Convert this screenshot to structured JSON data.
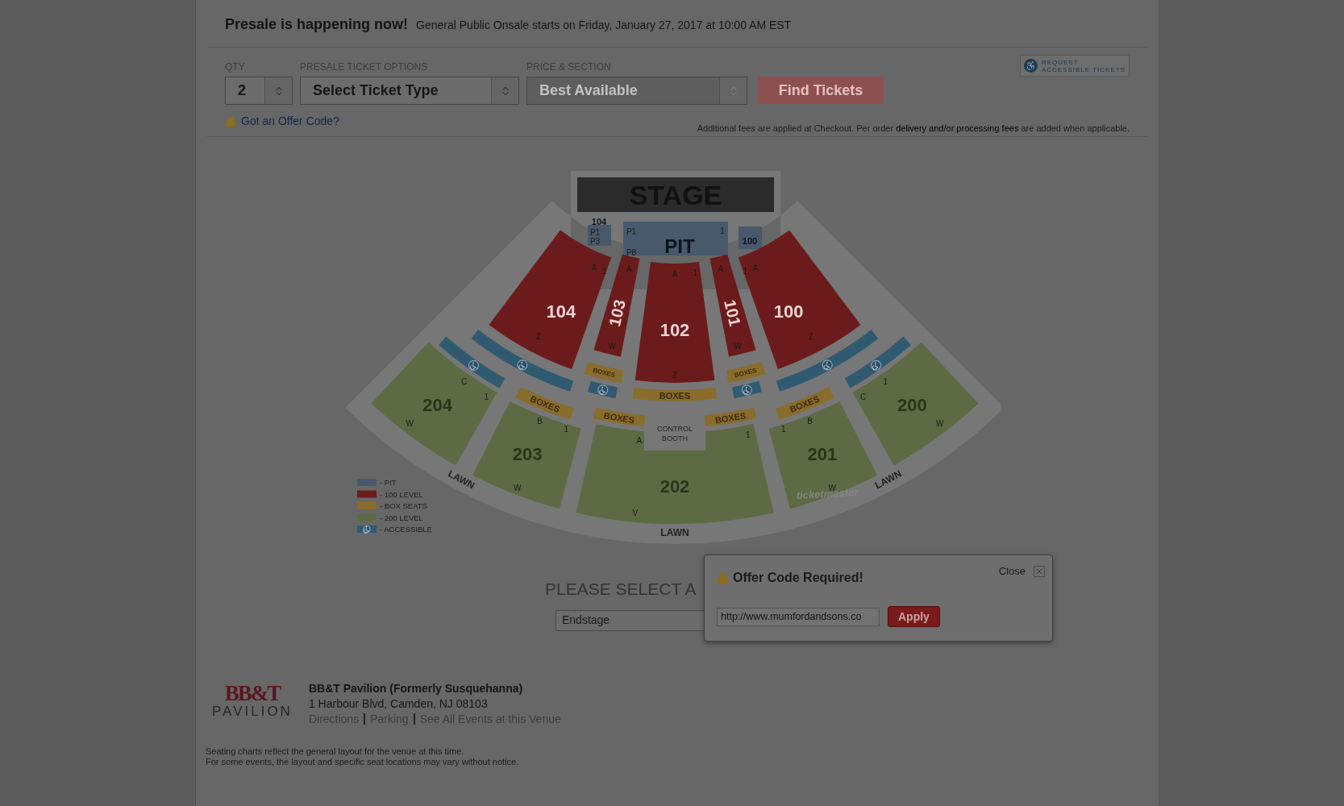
{
  "notice": {
    "title": "Presale is happening now!",
    "text": "General Public Onsale starts on Friday, January 27, 2017 at 10:00 AM EST"
  },
  "filters": [
    {
      "kind": "qty",
      "label": "QTY",
      "value": "2",
      "disabled": false
    },
    {
      "kind": "ticket_type",
      "label": "PRESALE TICKET OPTIONS",
      "value": "Select Ticket Type",
      "disabled": false
    },
    {
      "kind": "price",
      "label": "PRICE & SECTION",
      "value": "Best Available",
      "disabled": true
    }
  ],
  "find_button": {
    "label": "Find Tickets",
    "disabled": true
  },
  "accessible_button": {
    "lines": [
      "REQUEST",
      "ACCESSIBLE TICKETS"
    ]
  },
  "offer_link": "Got an Offer Code?",
  "fees_note": "Additional fees are applied at Checkout. Per order **delivery and/or processing fees** are added when applicable.",
  "seat_map": {
    "stage": "STAGE",
    "control_booth": [
      "CONTROL",
      "BOOTH"
    ],
    "lawn": [
      "LAWN",
      "LAWN",
      "LAWN"
    ],
    "credit": "ticketmaster",
    "sections": [
      {
        "kind": "pit",
        "label": "104",
        "marks": [
          "P1",
          "P3"
        ]
      },
      {
        "kind": "pit",
        "label": "PIT",
        "marks": [
          "P1",
          "P8",
          "1"
        ]
      },
      {
        "kind": "pit",
        "label": "100"
      },
      {
        "kind": "level100",
        "label": "104",
        "marks": [
          "A",
          "1",
          "Z"
        ]
      },
      {
        "kind": "level100",
        "label": "103",
        "marks": [
          "A",
          "W"
        ]
      },
      {
        "kind": "level100",
        "label": "102",
        "marks": [
          "A",
          "1",
          "Z"
        ]
      },
      {
        "kind": "level100",
        "label": "101",
        "marks": [
          "A",
          "W"
        ]
      },
      {
        "kind": "level100",
        "label": "100",
        "marks": [
          "1",
          "A",
          "Z"
        ]
      },
      {
        "kind": "box",
        "label": "BOXES"
      },
      {
        "kind": "box",
        "label": "BOXES"
      },
      {
        "kind": "accessible"
      },
      {
        "kind": "accessible"
      },
      {
        "kind": "box",
        "label": "BOXES"
      },
      {
        "kind": "accessible"
      },
      {
        "kind": "accessible"
      },
      {
        "kind": "accessible"
      },
      {
        "kind": "accessible"
      },
      {
        "kind": "box",
        "label": "BOXES"
      },
      {
        "kind": "box",
        "label": "BOXES"
      },
      {
        "kind": "box",
        "label": "BOXES"
      },
      {
        "kind": "box",
        "label": "BOXES"
      },
      {
        "kind": "level200",
        "label": "204",
        "marks": [
          "C",
          "1",
          "W"
        ]
      },
      {
        "kind": "level200",
        "label": "203",
        "marks": [
          "B",
          "1",
          "W"
        ]
      },
      {
        "kind": "level200",
        "label": "202",
        "marks": [
          "A",
          "1",
          "V"
        ]
      },
      {
        "kind": "level200",
        "label": "201",
        "marks": [
          "1",
          "B",
          "W"
        ]
      },
      {
        "kind": "level200",
        "label": "200",
        "marks": [
          "C",
          "1",
          "W"
        ]
      }
    ],
    "legend": [
      {
        "kind": "pit",
        "label": "- PIT"
      },
      {
        "kind": "level100",
        "label": "- 100 LEVEL"
      },
      {
        "kind": "box",
        "label": "- BOX SEATS"
      },
      {
        "kind": "level200",
        "label": "- 200 LEVEL"
      },
      {
        "kind": "accessible",
        "label": "- ACCESSIBLE"
      }
    ]
  },
  "layout_prompt": "PLEASE SELECT A",
  "layout_select": {
    "value": "Endstage"
  },
  "venue": {
    "logo_top": "BB&T",
    "logo_bottom": "PAVILION",
    "name": "BB&T Pavilion (Formerly Susquehanna)",
    "address": "1 Harbour Blvd, Camden, NJ 08103",
    "links": [
      "Directions",
      "Parking",
      "See All Events at this Venue"
    ]
  },
  "disclaimer": [
    "Seating charts reflect the general layout for the venue at this time.",
    "For some events, the layout and specific seat locations may vary without notice."
  ],
  "dialog": {
    "title": "Offer Code Required!",
    "close_label": "Close",
    "code_value": "http://www.mumfordandsons.co",
    "apply_label": "Apply"
  }
}
